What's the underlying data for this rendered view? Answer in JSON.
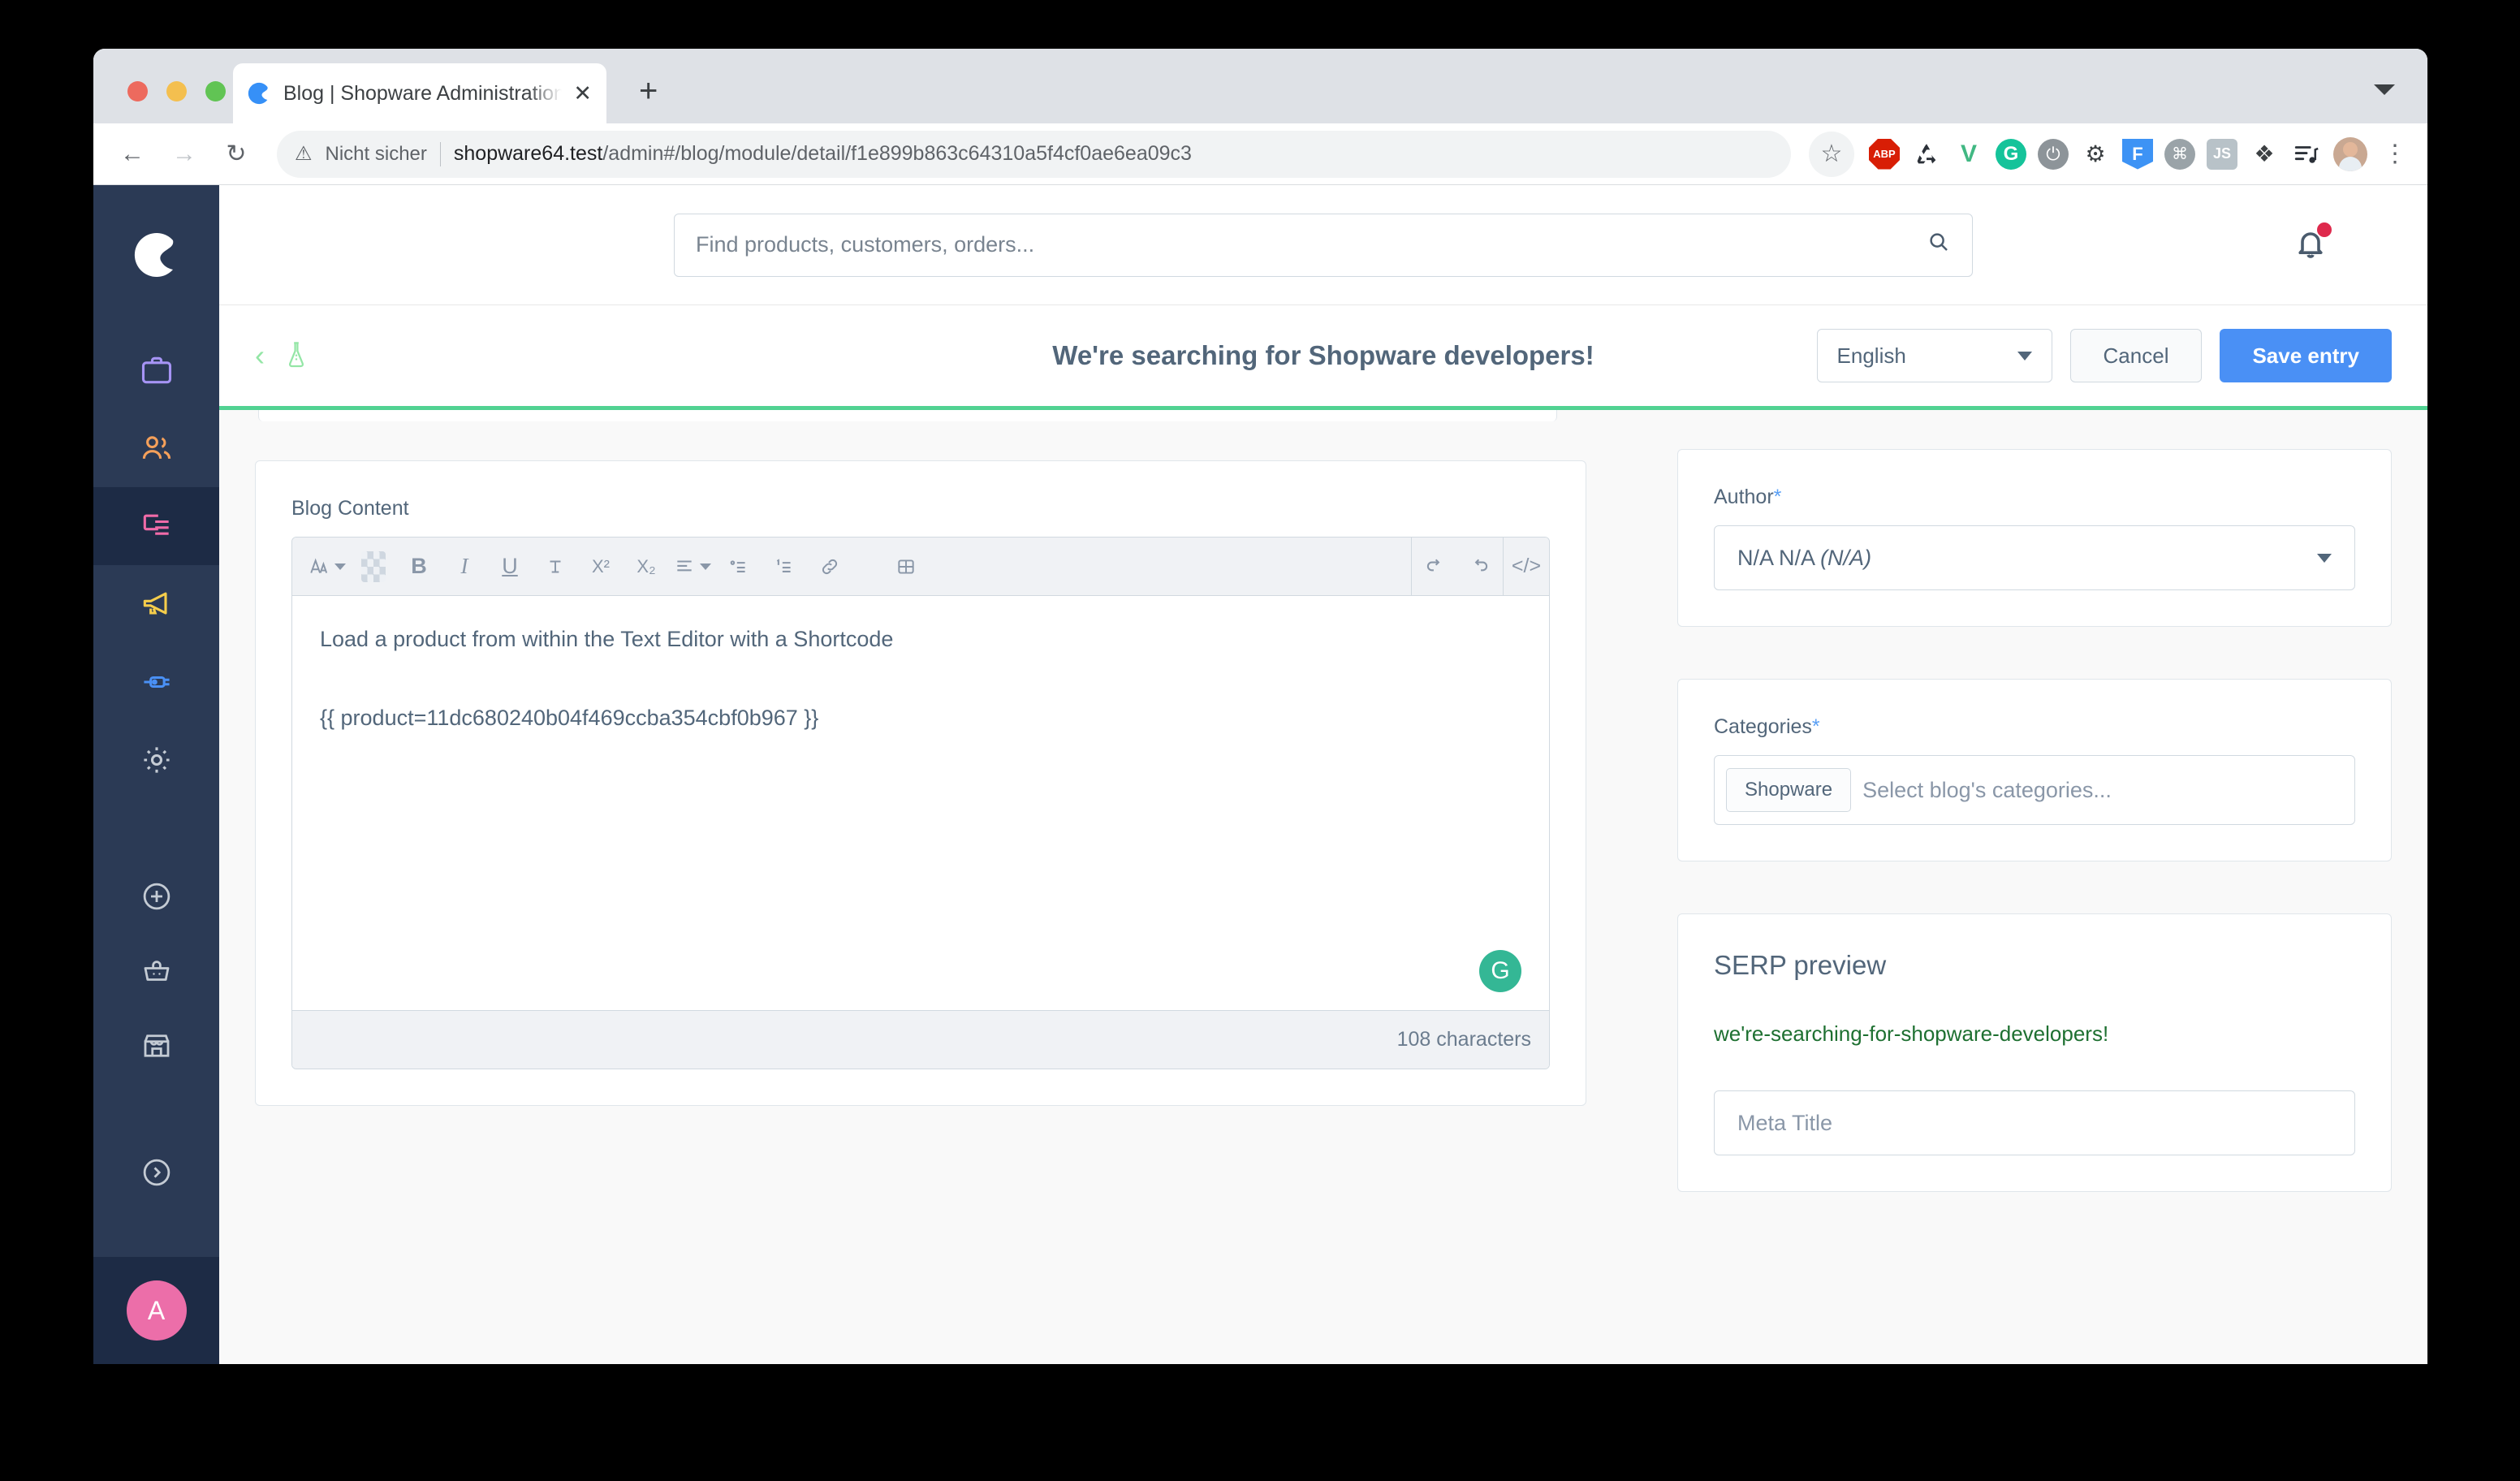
{
  "browser": {
    "tab": {
      "title": "Blog | Shopware Administration",
      "close_label": "✕",
      "favicon_name": "shopware-favicon"
    },
    "new_tab_label": "+",
    "nav": {
      "back": "←",
      "forward": "→",
      "reload": "↻"
    },
    "omnibox": {
      "warning_icon": "⚠",
      "security_text": "Nicht sicher",
      "url_host": "shopware64.test",
      "url_path": "/admin#/blog/module/detail/f1e899b863c64310a5f4cf0ae6ea09c3"
    },
    "bookmark_icon": "☆",
    "extensions": [
      {
        "name": "adblock-plus",
        "label": "ABP"
      },
      {
        "name": "recycle",
        "label": "♻"
      },
      {
        "name": "vue-devtools",
        "label": "V"
      },
      {
        "name": "grammarly",
        "label": "G"
      },
      {
        "name": "power",
        "label": "⏻"
      },
      {
        "name": "debug-bug",
        "label": "⚙"
      },
      {
        "name": "figma",
        "label": "F"
      },
      {
        "name": "command",
        "label": "⌘"
      },
      {
        "name": "javascript",
        "label": "JS"
      },
      {
        "name": "puzzle-extensions",
        "label": "❖"
      },
      {
        "name": "reading-list",
        "label": "♪"
      }
    ],
    "menu_label": "⋮"
  },
  "sidebar": {
    "logo_name": "shopware-logo",
    "items": [
      {
        "name": "catalogues",
        "color": "#a694f5",
        "active": false
      },
      {
        "name": "customers",
        "color": "#f5a05a",
        "active": false
      },
      {
        "name": "content",
        "color": "#f06ba8",
        "active": true
      },
      {
        "name": "marketing",
        "color": "#f5cd4b",
        "active": false
      },
      {
        "name": "extensions",
        "color": "#4a90f5",
        "active": false
      },
      {
        "name": "settings",
        "color": "#c4cbd4",
        "active": false
      }
    ],
    "utils": [
      {
        "name": "add-new",
        "color": "#c4cbd4"
      },
      {
        "name": "orders-basket",
        "color": "#c4cbd4"
      },
      {
        "name": "storefront",
        "color": "#c4cbd4"
      },
      {
        "name": "expand-menu",
        "color": "#c4cbd4"
      }
    ],
    "user_initial": "A"
  },
  "topbar": {
    "search_placeholder": "Find products, customers, orders...",
    "search_value": "",
    "search_icon": "search-icon",
    "notification_icon": "bell-icon",
    "notification_has_badge": true
  },
  "header": {
    "back_label": "‹",
    "flask_icon": "flask-icon",
    "title": "We're searching for Shopware developers!",
    "language": "English",
    "cancel_label": "Cancel",
    "save_label": "Save entry"
  },
  "editor": {
    "label": "Blog Content",
    "label_required": false,
    "toolbar": [
      {
        "name": "text-format-icon",
        "glyph": "A",
        "has_caret": true
      },
      {
        "name": "text-color-icon",
        "glyph": "swatch",
        "has_caret": false
      },
      {
        "name": "bold-icon",
        "glyph": "B",
        "has_caret": false
      },
      {
        "name": "italic-icon",
        "glyph": "I",
        "has_caret": false
      },
      {
        "name": "underline-icon",
        "glyph": "U",
        "has_caret": false
      },
      {
        "name": "strikethrough-icon",
        "glyph": "S",
        "has_caret": false
      },
      {
        "name": "superscript-icon",
        "glyph": "X²",
        "has_caret": false
      },
      {
        "name": "subscript-icon",
        "glyph": "X₂",
        "has_caret": false
      },
      {
        "name": "align-icon",
        "glyph": "align",
        "has_caret": true
      },
      {
        "name": "bullet-list-icon",
        "glyph": "ul",
        "has_caret": false
      },
      {
        "name": "ordered-list-icon",
        "glyph": "ol",
        "has_caret": false
      },
      {
        "name": "link-icon",
        "glyph": "link",
        "has_caret": false
      },
      {
        "name": "table-icon",
        "glyph": "table",
        "has_caret": false
      }
    ],
    "toolbar_right": [
      {
        "name": "undo-icon",
        "glyph": "↶"
      },
      {
        "name": "redo-icon",
        "glyph": "↷"
      },
      {
        "name": "source-code-icon",
        "glyph": "</>"
      }
    ],
    "paragraph_1": "Load a product from within the Text Editor with a Shortcode",
    "paragraph_2": "{{ product=11dc680240b04f469ccba354cbf0b967 }}",
    "grammarly_badge": "G",
    "character_count": "108 characters"
  },
  "author": {
    "label": "Author",
    "required_mark": "*",
    "value": "N/A N/A",
    "value_italic": "(N/A)"
  },
  "categories": {
    "label": "Categories",
    "required_mark": "*",
    "chips": [
      "Shopware"
    ],
    "placeholder": "Select blog's categories..."
  },
  "serp": {
    "title": "SERP preview",
    "slug": "we're-searching-for-shopware-developers!",
    "meta_title_placeholder": "Meta Title"
  }
}
